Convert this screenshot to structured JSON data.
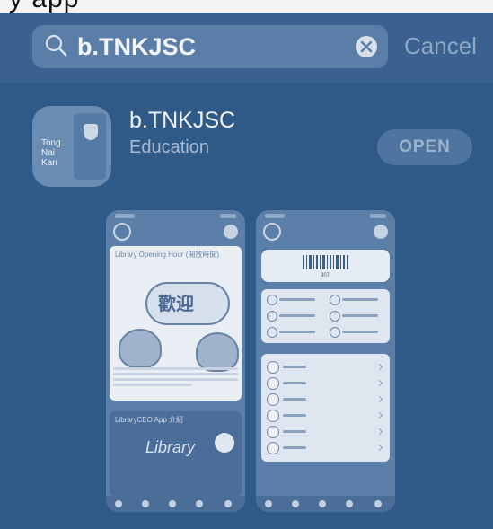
{
  "status_bar": {
    "partial_text": "y app"
  },
  "search": {
    "value": "b.TNKJSC",
    "cancel_label": "Cancel"
  },
  "app": {
    "name": "b.TNKJSC",
    "category": "Education",
    "open_label": "OPEN",
    "icon_text": "Tong\nNai\nKan"
  },
  "screenshots": [
    {
      "title": "Library Opening Hour (開放時間)",
      "banner_title": "LibraryCEO App 介紹",
      "banner_logo": "Library"
    },
    {
      "barcode_number": "907"
    }
  ],
  "colors": {
    "background": "#2f5a87",
    "search_field": "#5b7ea8",
    "open_button": "#4f74a0"
  }
}
